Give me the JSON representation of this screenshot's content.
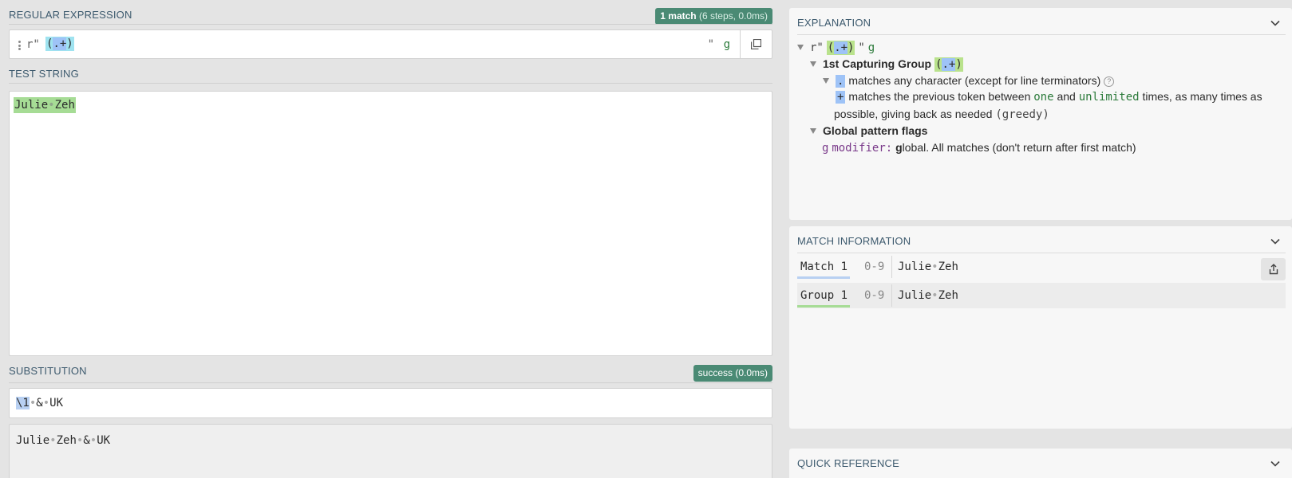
{
  "regex_section": {
    "title": "REGULAR EXPRESSION",
    "badge_strong": "1 match",
    "badge_detail": "(6 steps, 0.0ms)",
    "delimiter_open": "r\"",
    "pattern_open": "(",
    "pattern_inner": ".+",
    "pattern_close": ")",
    "delimiter_close": "\"",
    "flags": "g"
  },
  "test_section": {
    "title": "TEST STRING",
    "word1": "Julie",
    "word2": "Zeh",
    "space_glyph": "•"
  },
  "substitution_section": {
    "title": "SUBSTITUTION",
    "badge": "success (0.0ms)",
    "backref": "\\1",
    "amp": "&",
    "tail": "UK",
    "result_parts": [
      "Julie",
      "Zeh",
      "&",
      "UK"
    ]
  },
  "explanation": {
    "title": "EXPLANATION",
    "root_open": "r\"",
    "root_group_open": "(",
    "root_group_inner": ".+",
    "root_group_close": ")",
    "root_close": "\"",
    "root_flag": "g",
    "group_label": "1st Capturing Group",
    "group_open": "(",
    "group_inner": ".+",
    "group_close": ")",
    "dot_token": ".",
    "dot_text": "matches any character (except for line terminators)",
    "info_glyph": "?",
    "plus_token": "+",
    "plus_text_1": "matches the previous token between",
    "plus_one": "one",
    "plus_and": "and",
    "plus_unlimited": "unlimited",
    "plus_text_2": "times, as many times as",
    "plus_text_3": "possible, giving back as needed",
    "plus_greedy": "(greedy)",
    "flags_label": "Global pattern flags",
    "flag_g": "g",
    "flag_modifier": "modifier:",
    "flag_g_bold": "g",
    "flag_text": "lobal. All matches (don't return after first match)"
  },
  "match_info": {
    "title": "MATCH INFORMATION",
    "rows": [
      {
        "label": "Match 1",
        "range": "0-9",
        "value_a": "Julie",
        "value_b": "Zeh",
        "color": "#b8d0f2"
      },
      {
        "label": "Group 1",
        "range": "0-9",
        "value_a": "Julie",
        "value_b": "Zeh",
        "color": "#a6dc95"
      }
    ]
  },
  "quick_reference": {
    "title": "QUICK REFERENCE"
  },
  "colors": {
    "badge": "#4a8a74",
    "match_highlight": "#a6dc95",
    "group_highlight": "#9fe3f0",
    "token_highlight": "#9ec3f7",
    "section_title": "#3d5a6e"
  },
  "icons": [
    "grip-icon",
    "copy-icon",
    "chevron-down-icon",
    "info-icon",
    "share-icon"
  ]
}
